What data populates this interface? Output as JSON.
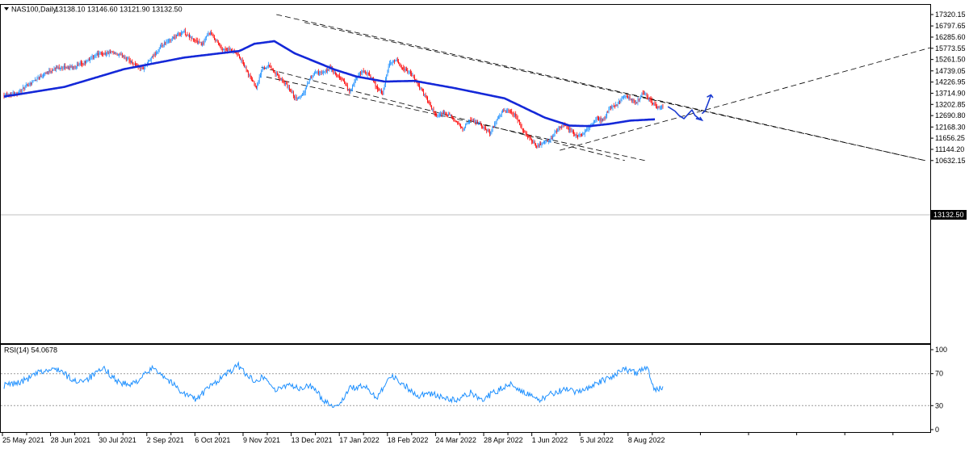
{
  "header": {
    "symbol": "NAS100,Daily",
    "ohlc": "13138.10 13146.60 13121.90 13132.50"
  },
  "rsi_panel": {
    "label": "RSI(14) 54.0678",
    "levels": [
      "100",
      "70",
      "30",
      "0"
    ]
  },
  "price_tag": "13132.50",
  "colors": {
    "bull": "#1e90ff",
    "bear": "#ff0000",
    "ma": "#1428d8",
    "rsi": "#1e90ff",
    "arrow": "#1a3ad0",
    "channel": "#000000",
    "tag_bg": "#000000"
  },
  "chart_data": [
    {
      "type": "candlestick",
      "title": "NAS100,Daily",
      "y_axis_ticks": [
        "17320.15",
        "16797.65",
        "16285.60",
        "15773.55",
        "15261.50",
        "14739.05",
        "14226.95",
        "13714.90",
        "13202.85",
        "12690.80",
        "12168.30",
        "11656.25",
        "11144.20",
        "10632.15"
      ],
      "x_axis_ticks": [
        "25 May 2021",
        "28 Jun 2021",
        "30 Jul 2021",
        "2 Sep 2021",
        "6 Oct 2021",
        "9 Nov 2021",
        "13 Dec 2021",
        "17 Jan 2022",
        "18 Feb 2022",
        "24 Mar 2022",
        "28 Apr 2022",
        "1 Jun 2022",
        "5 Jul 2022",
        "8 Aug 2022"
      ],
      "ylim": [
        10440,
        17440
      ],
      "last_close": 13132.5,
      "close_anchors": [
        [
          0,
          13640
        ],
        [
          14,
          13740
        ],
        [
          27,
          14200
        ],
        [
          40,
          14620
        ],
        [
          53,
          14880
        ],
        [
          66,
          14900
        ],
        [
          79,
          15060
        ],
        [
          92,
          15500
        ],
        [
          106,
          15560
        ],
        [
          119,
          15420
        ],
        [
          130,
          15050
        ],
        [
          138,
          14820
        ],
        [
          145,
          15200
        ],
        [
          158,
          15890
        ],
        [
          171,
          16320
        ],
        [
          179,
          16550
        ],
        [
          185,
          16300
        ],
        [
          192,
          16100
        ],
        [
          198,
          15950
        ],
        [
          205,
          16500
        ],
        [
          212,
          16120
        ],
        [
          218,
          15730
        ],
        [
          225,
          15700
        ],
        [
          232,
          15550
        ],
        [
          238,
          15150
        ],
        [
          245,
          14500
        ],
        [
          252,
          14000
        ],
        [
          258,
          14850
        ],
        [
          265,
          15000
        ],
        [
          272,
          14550
        ],
        [
          279,
          14240
        ],
        [
          285,
          13900
        ],
        [
          292,
          13420
        ],
        [
          299,
          13700
        ],
        [
          305,
          14350
        ],
        [
          312,
          14700
        ],
        [
          318,
          14600
        ],
        [
          325,
          14900
        ],
        [
          332,
          14500
        ],
        [
          338,
          14350
        ],
        [
          345,
          13750
        ],
        [
          352,
          14400
        ],
        [
          358,
          14750
        ],
        [
          365,
          14550
        ],
        [
          372,
          14000
        ],
        [
          378,
          13700
        ],
        [
          385,
          15100
        ],
        [
          392,
          15200
        ],
        [
          398,
          14850
        ],
        [
          405,
          14700
        ],
        [
          412,
          14200
        ],
        [
          418,
          13800
        ],
        [
          425,
          13200
        ],
        [
          432,
          12600
        ],
        [
          438,
          12820
        ],
        [
          445,
          12700
        ],
        [
          452,
          12350
        ],
        [
          458,
          12100
        ],
        [
          465,
          12450
        ],
        [
          472,
          12400
        ],
        [
          478,
          12150
        ],
        [
          485,
          11900
        ],
        [
          492,
          12450
        ],
        [
          498,
          12900
        ],
        [
          505,
          12880
        ],
        [
          512,
          12600
        ],
        [
          518,
          12000
        ],
        [
          525,
          11650
        ],
        [
          532,
          11300
        ],
        [
          538,
          11450
        ],
        [
          545,
          11550
        ],
        [
          552,
          12000
        ],
        [
          558,
          12280
        ],
        [
          565,
          12050
        ],
        [
          572,
          11750
        ],
        [
          578,
          11850
        ],
        [
          585,
          12200
        ],
        [
          592,
          12580
        ],
        [
          598,
          12450
        ],
        [
          605,
          13050
        ],
        [
          612,
          13200
        ],
        [
          618,
          13580
        ],
        [
          625,
          13500
        ],
        [
          632,
          13300
        ],
        [
          638,
          13750
        ],
        [
          645,
          13420
        ],
        [
          652,
          13050
        ],
        [
          658,
          13132.5
        ]
      ],
      "series": [
        {
          "name": "",
          "type": "moving-average",
          "values": [
            [
              0,
              13560
            ],
            [
              60,
              14000
            ],
            [
              120,
              14820
            ],
            [
              180,
              15350
            ],
            [
              235,
              15650
            ],
            [
              250,
              15980
            ],
            [
              270,
              16100
            ],
            [
              290,
              15550
            ],
            [
              330,
              14800
            ],
            [
              352,
              14480
            ],
            [
              380,
              14250
            ],
            [
              410,
              14280
            ],
            [
              450,
              13950
            ],
            [
              500,
              13480
            ],
            [
              540,
              12600
            ],
            [
              565,
              12230
            ],
            [
              585,
              12210
            ],
            [
              605,
              12310
            ],
            [
              625,
              12460
            ],
            [
              650,
              12520
            ]
          ]
        }
      ]
    },
    {
      "type": "line",
      "title": "RSI(14) 54.0678",
      "ylim": [
        0,
        100
      ],
      "levels": [
        70,
        30
      ],
      "anchors": [
        [
          0,
          55
        ],
        [
          18,
          60
        ],
        [
          36,
          72
        ],
        [
          54,
          76
        ],
        [
          70,
          60
        ],
        [
          84,
          64
        ],
        [
          100,
          76
        ],
        [
          114,
          60
        ],
        [
          126,
          55
        ],
        [
          138,
          66
        ],
        [
          150,
          78
        ],
        [
          164,
          62
        ],
        [
          180,
          45
        ],
        [
          192,
          38
        ],
        [
          204,
          52
        ],
        [
          218,
          66
        ],
        [
          234,
          80
        ],
        [
          248,
          62
        ],
        [
          260,
          66
        ],
        [
          272,
          48
        ],
        [
          284,
          58
        ],
        [
          296,
          50
        ],
        [
          306,
          56
        ],
        [
          318,
          38
        ],
        [
          332,
          28
        ],
        [
          346,
          52
        ],
        [
          360,
          54
        ],
        [
          372,
          40
        ],
        [
          386,
          68
        ],
        [
          400,
          56
        ],
        [
          412,
          42
        ],
        [
          424,
          46
        ],
        [
          438,
          40
        ],
        [
          452,
          36
        ],
        [
          466,
          46
        ],
        [
          478,
          38
        ],
        [
          492,
          48
        ],
        [
          506,
          58
        ],
        [
          520,
          46
        ],
        [
          534,
          36
        ],
        [
          548,
          46
        ],
        [
          560,
          50
        ],
        [
          572,
          46
        ],
        [
          588,
          56
        ],
        [
          604,
          64
        ],
        [
          618,
          76
        ],
        [
          632,
          70
        ],
        [
          642,
          78
        ],
        [
          650,
          50
        ],
        [
          658,
          54
        ]
      ]
    }
  ]
}
